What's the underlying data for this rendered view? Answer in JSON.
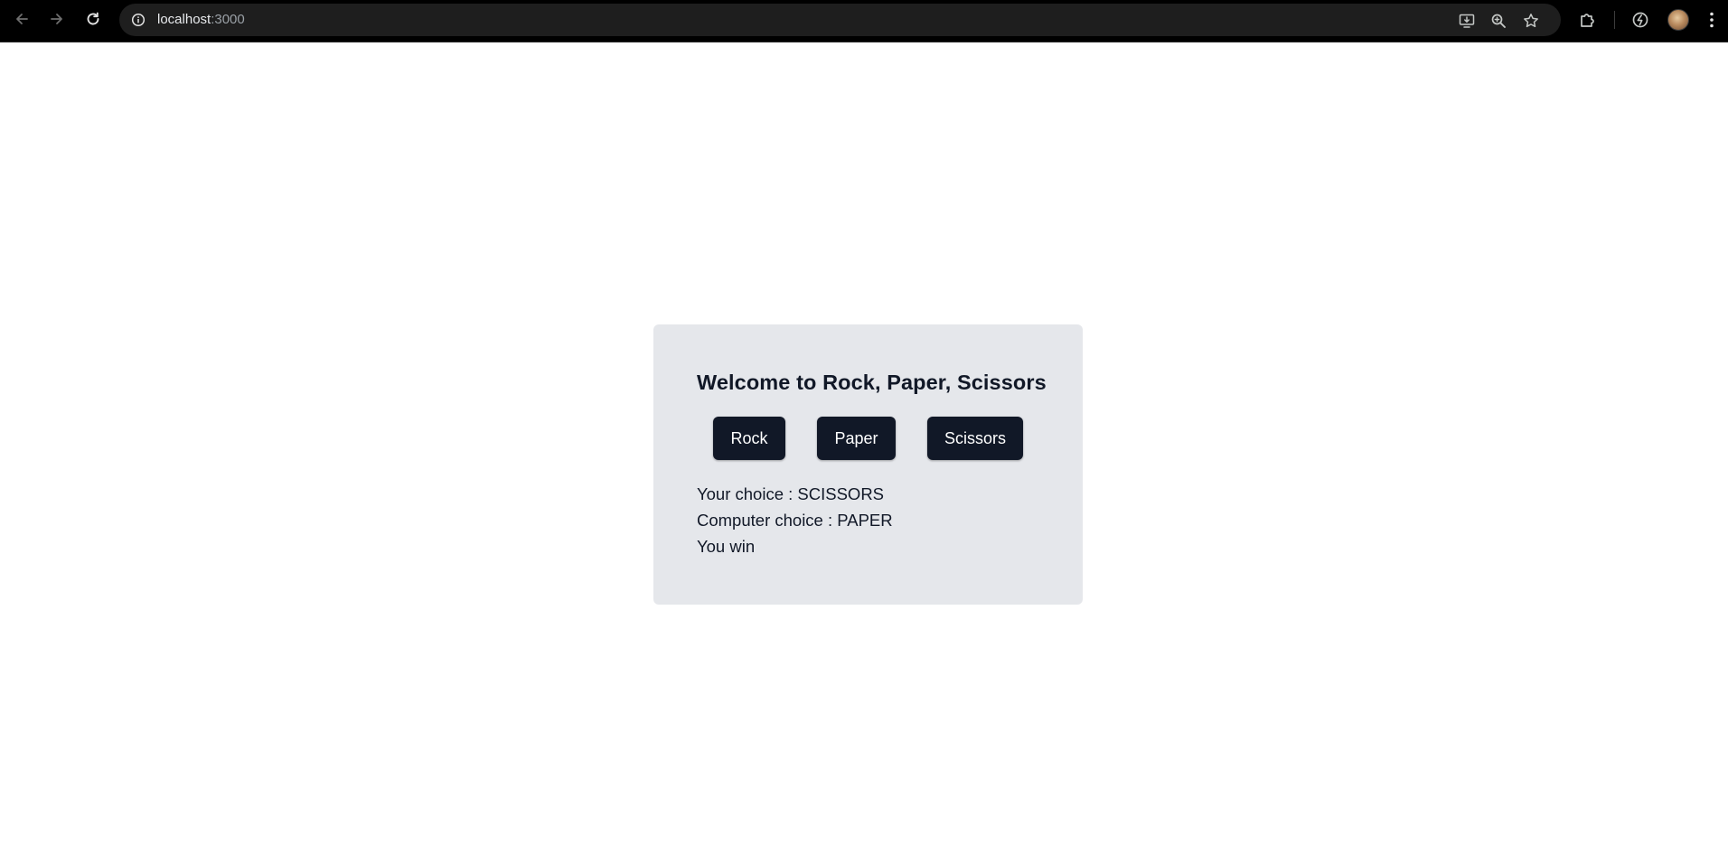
{
  "browser": {
    "url_host": "localhost",
    "url_port": ":3000",
    "icons": {
      "back": "arrow-left-icon",
      "forward": "arrow-right-icon",
      "reload": "reload-icon",
      "site_info": "info-icon",
      "install": "install-app-icon",
      "zoom": "zoom-icon",
      "bookmark": "star-icon",
      "extensions": "puzzle-icon",
      "sync": "sync-icon",
      "menu": "kebab-menu-icon"
    },
    "colors": {
      "toolbar_bg": "#000000",
      "omnibox_bg": "#1e1e1e",
      "icon": "#c4c7c5"
    }
  },
  "game": {
    "title": "Welcome to Rock, Paper, Scissors",
    "buttons": {
      "rock": "Rock",
      "paper": "Paper",
      "scissors": "Scissors"
    },
    "result": {
      "your_choice": "Your choice : SCISSORS",
      "computer_choice": "Computer choice : PAPER",
      "outcome": "You win"
    },
    "colors": {
      "card_bg": "#e5e7eb",
      "button_bg": "#111827",
      "button_text": "#ffffff",
      "text": "#111827"
    }
  }
}
